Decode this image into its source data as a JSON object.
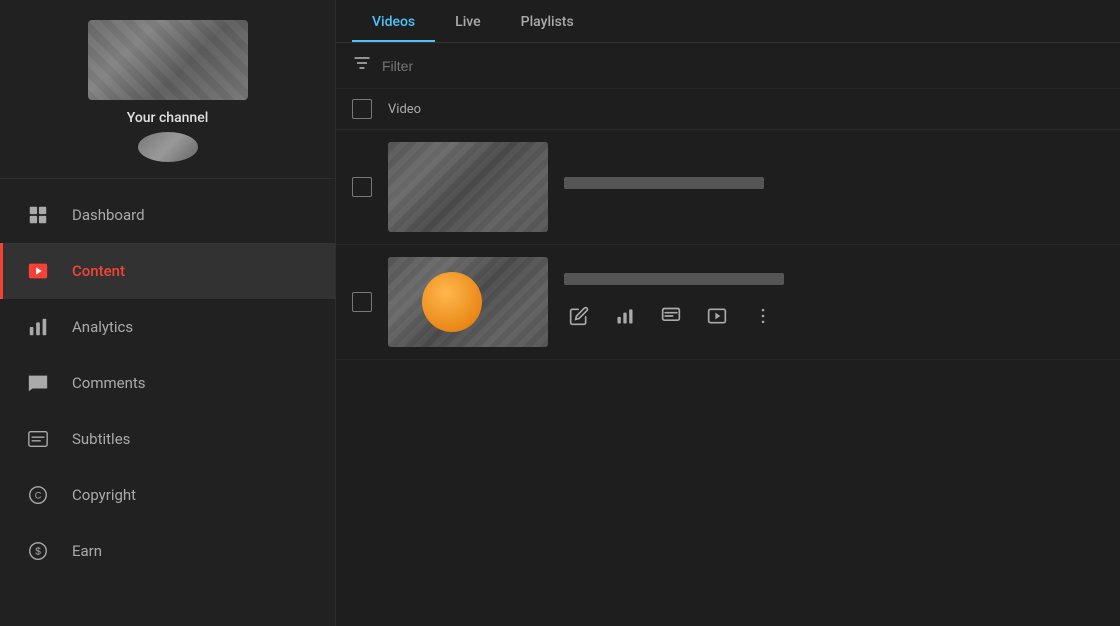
{
  "sidebar": {
    "channel_name": "Your channel",
    "nav_items": [
      {
        "id": "dashboard",
        "label": "Dashboard",
        "active": false
      },
      {
        "id": "content",
        "label": "Content",
        "active": true
      },
      {
        "id": "analytics",
        "label": "Analytics",
        "active": false
      },
      {
        "id": "comments",
        "label": "Comments",
        "active": false
      },
      {
        "id": "subtitles",
        "label": "Subtitles",
        "active": false
      },
      {
        "id": "copyright",
        "label": "Copyright",
        "active": false
      },
      {
        "id": "earn",
        "label": "Earn",
        "active": false
      }
    ]
  },
  "main": {
    "tabs": [
      {
        "id": "videos",
        "label": "Videos",
        "active": true
      },
      {
        "id": "live",
        "label": "Live",
        "active": false
      },
      {
        "id": "playlists",
        "label": "Playlists",
        "active": false
      }
    ],
    "filter_placeholder": "Filter",
    "col_headers": [
      "Video"
    ],
    "video_rows": [
      {
        "id": "row1",
        "has_circle": false
      },
      {
        "id": "row2",
        "has_circle": true
      }
    ],
    "action_buttons": [
      {
        "id": "edit",
        "icon": "pencil"
      },
      {
        "id": "analytics",
        "icon": "bar-chart"
      },
      {
        "id": "comments",
        "icon": "comment"
      },
      {
        "id": "play",
        "icon": "play"
      },
      {
        "id": "more",
        "icon": "ellipsis"
      }
    ]
  },
  "colors": {
    "active_tab": "#4fc3f7",
    "active_nav": "#f44336",
    "orange_circle": "#e07400",
    "sidebar_bg": "#212121",
    "main_bg": "#1e1e1e"
  }
}
